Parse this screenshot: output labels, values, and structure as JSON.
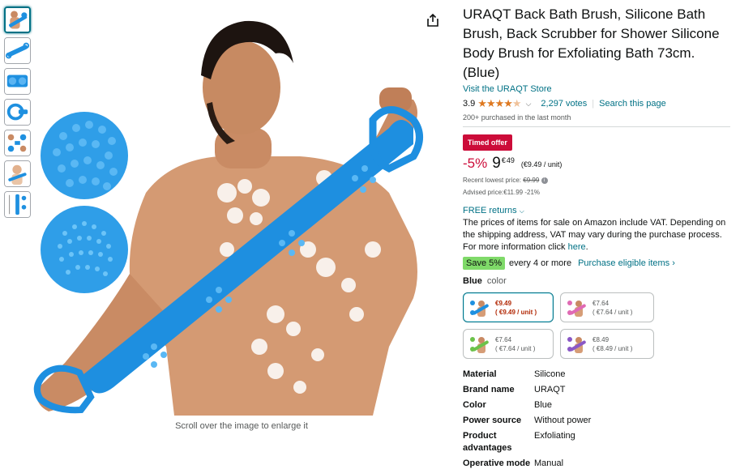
{
  "thumbnails": [
    {
      "name": "thumb-man-brush",
      "active": true
    },
    {
      "name": "thumb-brush-product"
    },
    {
      "name": "thumb-silicone-closeup"
    },
    {
      "name": "thumb-brush-loop"
    },
    {
      "name": "thumb-features"
    },
    {
      "name": "thumb-woman-brush"
    },
    {
      "name": "thumb-size-chart"
    }
  ],
  "image": {
    "zoom_hint": "Scroll over the image to enlarge it"
  },
  "product": {
    "title": "URAQT Back Bath Brush, Silicone Bath Brush, Back Scrubber for Shower Silicone Body Brush for Exfoliating Bath 73cm. (Blue)",
    "store_link": "Visit the URAQT Store",
    "rating": "3.9",
    "stars_value": 3.9,
    "votes": "2,297 votes",
    "search_page": "Search this page",
    "purchased": "200+ purchased in the last month"
  },
  "pricing": {
    "deal_badge": "Timed offer",
    "discount": "-5%",
    "price_whole": "9",
    "price_currency": "€",
    "price_fraction": "49",
    "unit_price": "(€9.49 / unit)",
    "recent_lowest_label": "Recent lowest price:",
    "recent_lowest_value": "€9.99",
    "advised_label": "Advised price:",
    "advised_value": "€11.99",
    "advised_discount": "-21%",
    "returns": "FREE returns",
    "vat_text": "The prices of items for sale on Amazon include VAT. Depending on the shipping address, VAT may vary during the purchase process. For more information click",
    "vat_link": "here",
    "vat_end": "."
  },
  "subscribe": {
    "badge": "Save 5%",
    "text": "every 4 or more",
    "link": "Purchase eligible items ›"
  },
  "color": {
    "selected_name": "Blue",
    "label": "color",
    "options": [
      {
        "price": "€9.49",
        "unit": "( €9.49 / unit )",
        "tint": "#1e90e0",
        "selected": true
      },
      {
        "price": "€7.64",
        "unit": "( €7.64 / unit )",
        "tint": "#e06ab4"
      },
      {
        "price": "€7.64",
        "unit": "( €7.64 / unit )",
        "tint": "#6cc24a"
      },
      {
        "price": "€8.49",
        "unit": "( €8.49 / unit )",
        "tint": "#8a58c6"
      }
    ]
  },
  "specs": [
    {
      "key": "Material",
      "value": "Silicone"
    },
    {
      "key": "Brand name",
      "value": "URAQT"
    },
    {
      "key": "Color",
      "value": "Blue"
    },
    {
      "key": "Power source",
      "value": "Without power"
    },
    {
      "key": "Product advantages",
      "value": "Exfoliating"
    },
    {
      "key": "Operative mode",
      "value": "Manual"
    }
  ],
  "colors": {
    "link": "#007185",
    "deal_red": "#cc0c39",
    "star_orange": "#de7921",
    "save_green": "#7fda69",
    "brush_blue": "#1e90e0"
  }
}
